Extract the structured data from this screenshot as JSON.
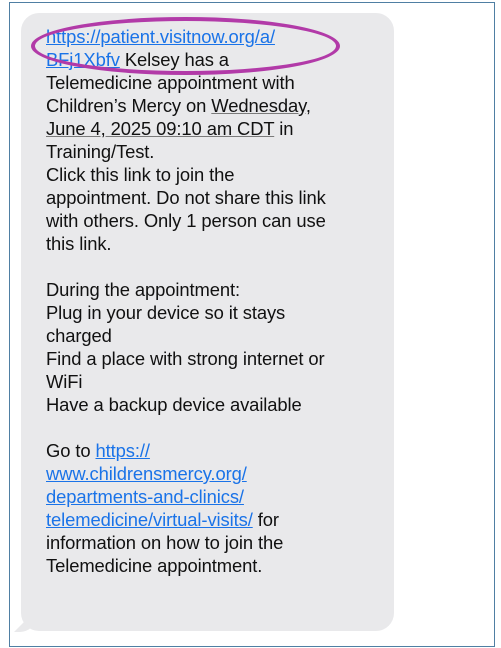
{
  "message": {
    "link1_part1": "https://patient.visitnow.org/a/",
    "link1_part2": "BFj1Xbfv",
    "after_link1": " Kelsey  has a",
    "line_appt": "Telemedicine appointment with",
    "line_org_prefix": "Children’s Mercy on ",
    "weekday": "Wednesday,",
    "date_time": "June 4, 2025 09:10 am CDT",
    "after_date": " in",
    "location": "Training/Test.",
    "instr_1": "Click this link to join the",
    "instr_2": "appointment. Do not share this link",
    "instr_3": "with others. Only 1 person can use",
    "instr_4": "this link.",
    "during_header": "During the appointment:",
    "tip_1a": "Plug in your device so it stays",
    "tip_1b": "charged",
    "tip_2a": "Find a place with strong internet or",
    "tip_2b": "WiFi",
    "tip_3": "Have a backup device available",
    "goto_prefix": "Go to ",
    "link2_part1": "https://",
    "link2_part2": "www.childrensmercy.org/",
    "link2_part3": "departments-and-clinics/",
    "link2_part4": "telemedicine/virtual-visits/",
    "after_link2": " for",
    "info_1": "information on how to join the",
    "info_2": "Telemedicine appointment."
  },
  "colors": {
    "bubble": "#e9e9eb",
    "link": "#1a73e8",
    "highlight": "#b23aa8",
    "frame_border": "#4f7fa3"
  }
}
